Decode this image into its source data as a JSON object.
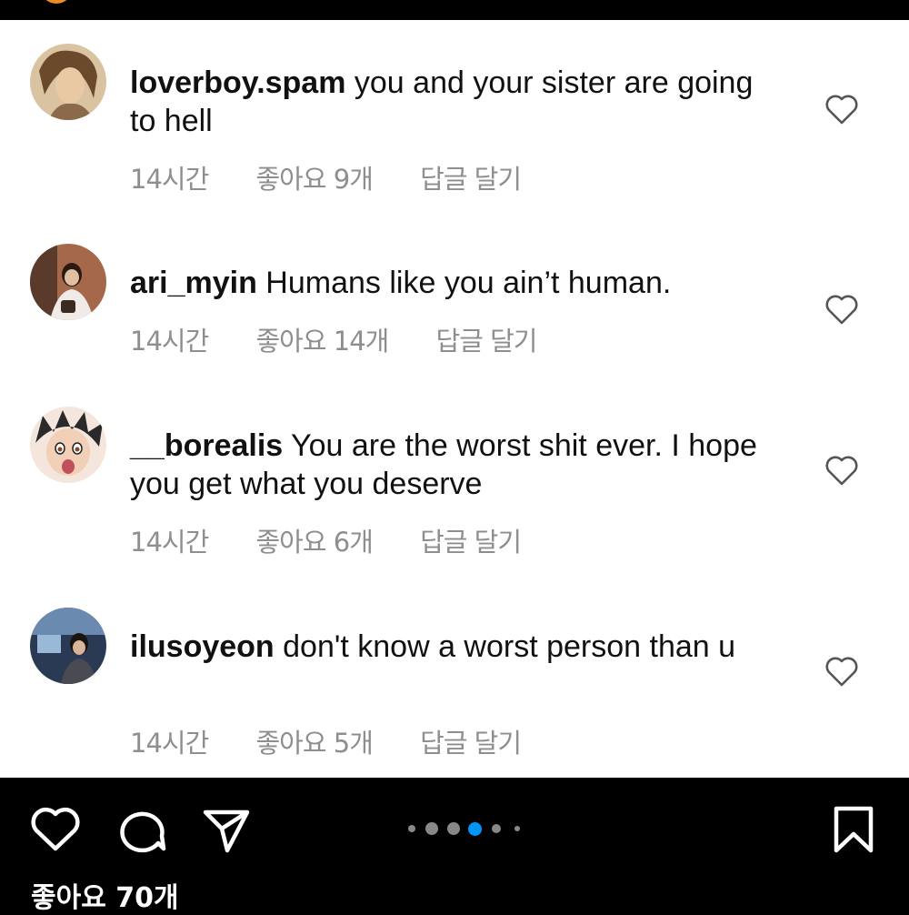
{
  "comments": [
    {
      "username": "loverboy.spam",
      "text": " you and your sister are going to hell",
      "time": "14시간",
      "likes": "좋아요 9개",
      "reply": "답글 달기",
      "avatar_color": "#8a6a4a"
    },
    {
      "username": "ari_myin",
      "text": " Humans like you ain’t human.",
      "time": "14시간",
      "likes": "좋아요 14개",
      "reply": "답글 달기",
      "avatar_color": "#7a4a3a"
    },
    {
      "username": "__borealis",
      "text": " You are the worst shit ever. I hope you get what you deserve",
      "time": "14시간",
      "likes": "좋아요 6개",
      "reply": "답글 달기",
      "avatar_color": "#c9a48a"
    },
    {
      "username": "ilusoyeon",
      "text": " don't know a worst person than u",
      "time": "14시간",
      "likes": "좋아요 5개",
      "reply": "답글 달기",
      "avatar_color": "#3a5a7a"
    }
  ],
  "bottom": {
    "likes_text": "좋아요 70개",
    "icons": [
      "heart-icon",
      "comment-icon",
      "share-icon",
      "bookmark-icon"
    ],
    "carousel_active_index": 3,
    "carousel_count": 6,
    "accent": "#0095f6"
  }
}
